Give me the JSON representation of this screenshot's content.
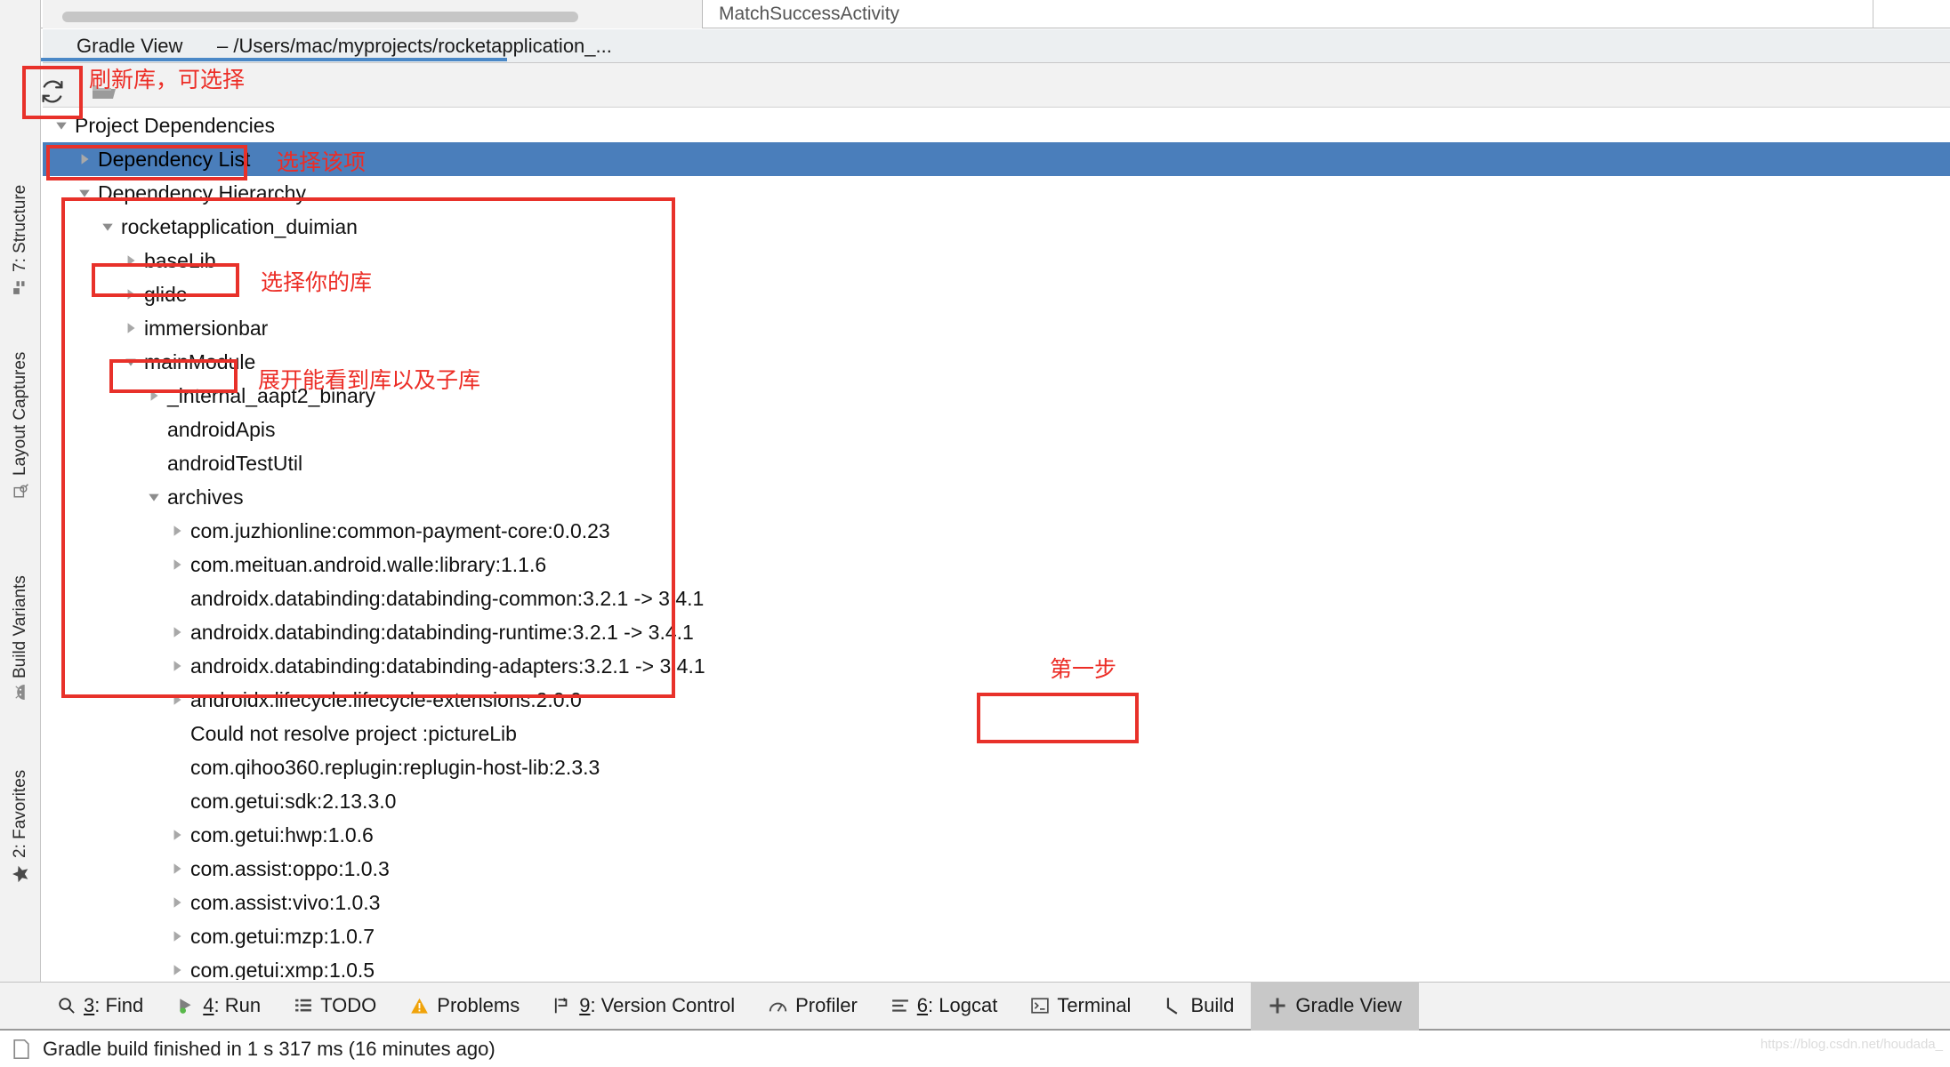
{
  "window": {
    "editor_tab": "MatchSuccessActivity"
  },
  "gradle_view": {
    "title": "Gradle View",
    "separator": "–",
    "project_path": "/Users/mac/myprojects/rocketapplication_...",
    "toolbar": {
      "refresh_icon": "refresh-icon",
      "folder_icon": "folder-icon"
    }
  },
  "sidebar": {
    "items": [
      {
        "label": "7: Structure",
        "icon": "structure-icon"
      },
      {
        "label": "Layout Captures",
        "icon": "layout-captures-icon"
      },
      {
        "label": "Build Variants",
        "icon": "android-icon"
      },
      {
        "label": "2: Favorites",
        "icon": "star-icon"
      }
    ]
  },
  "tree": {
    "rows": [
      {
        "label": "Project Dependencies",
        "indent": 0,
        "twisty": "down",
        "selected": false
      },
      {
        "label": "Dependency List",
        "indent": 1,
        "twisty": "right",
        "selected": true
      },
      {
        "label": "Dependency Hierarchy",
        "indent": 1,
        "twisty": "down",
        "selected": false
      },
      {
        "label": "rocketapplication_duimian",
        "indent": 2,
        "twisty": "down",
        "selected": false
      },
      {
        "label": "baseLib",
        "indent": 3,
        "twisty": "right",
        "selected": false
      },
      {
        "label": "glide",
        "indent": 3,
        "twisty": "right",
        "selected": false
      },
      {
        "label": "immersionbar",
        "indent": 3,
        "twisty": "right",
        "selected": false
      },
      {
        "label": "mainModule",
        "indent": 3,
        "twisty": "down",
        "selected": false
      },
      {
        "label": "_internal_aapt2_binary",
        "indent": 4,
        "twisty": "right",
        "selected": false
      },
      {
        "label": "androidApis",
        "indent": 4,
        "twisty": "none",
        "selected": false
      },
      {
        "label": "androidTestUtil",
        "indent": 4,
        "twisty": "none",
        "selected": false
      },
      {
        "label": "archives",
        "indent": 4,
        "twisty": "down",
        "selected": false
      },
      {
        "label": "com.juzhionline:common-payment-core:0.0.23",
        "indent": 5,
        "twisty": "right",
        "selected": false
      },
      {
        "label": "com.meituan.android.walle:library:1.1.6",
        "indent": 5,
        "twisty": "right",
        "selected": false
      },
      {
        "label": "androidx.databinding:databinding-common:3.2.1 -> 3.4.1",
        "indent": 5,
        "twisty": "none",
        "selected": false
      },
      {
        "label": "androidx.databinding:databinding-runtime:3.2.1 -> 3.4.1",
        "indent": 5,
        "twisty": "right",
        "selected": false
      },
      {
        "label": "androidx.databinding:databinding-adapters:3.2.1 -> 3.4.1",
        "indent": 5,
        "twisty": "right",
        "selected": false
      },
      {
        "label": "androidx.lifecycle:lifecycle-extensions:2.0.0",
        "indent": 5,
        "twisty": "right",
        "selected": false
      },
      {
        "label": "Could not resolve project :pictureLib",
        "indent": 5,
        "twisty": "none",
        "selected": false
      },
      {
        "label": "com.qihoo360.replugin:replugin-host-lib:2.3.3",
        "indent": 5,
        "twisty": "none",
        "selected": false
      },
      {
        "label": "com.getui:sdk:2.13.3.0",
        "indent": 5,
        "twisty": "none",
        "selected": false
      },
      {
        "label": "com.getui:hwp:1.0.6",
        "indent": 5,
        "twisty": "right",
        "selected": false
      },
      {
        "label": "com.assist:oppo:1.0.3",
        "indent": 5,
        "twisty": "right",
        "selected": false
      },
      {
        "label": "com.assist:vivo:1.0.3",
        "indent": 5,
        "twisty": "right",
        "selected": false
      },
      {
        "label": "com.getui:mzp:1.0.7",
        "indent": 5,
        "twisty": "right",
        "selected": false
      },
      {
        "label": "com.getui:xmp:1.0.5",
        "indent": 5,
        "twisty": "right",
        "selected": false
      }
    ]
  },
  "annotations": {
    "color": "#ec2d26",
    "refresh_note": "刷新库，可选择",
    "select_item_note": "选择该项",
    "select_lib_note": "选择你的库",
    "expand_note": "展开能看到库以及子库",
    "first_step_note": "第一步"
  },
  "bottom_bar": {
    "items": [
      {
        "label": "3: Find",
        "shortcut": "3",
        "text": ": Find",
        "icon": "search-icon",
        "active": false
      },
      {
        "label": "4: Run",
        "shortcut": "4",
        "text": ": Run",
        "icon": "run-icon",
        "active": false
      },
      {
        "label": "TODO",
        "shortcut": "",
        "text": "TODO",
        "icon": "todo-icon",
        "active": false
      },
      {
        "label": "Problems",
        "shortcut": "",
        "text": "Problems",
        "icon": "warning-icon",
        "active": false
      },
      {
        "label": "9: Version Control",
        "shortcut": "9",
        "text": ": Version Control",
        "icon": "version-control-icon",
        "active": false
      },
      {
        "label": "Profiler",
        "shortcut": "",
        "text": "Profiler",
        "icon": "profiler-icon",
        "active": false
      },
      {
        "label": "6: Logcat",
        "shortcut": "6",
        "text": ": Logcat",
        "icon": "logcat-icon",
        "active": false
      },
      {
        "label": "Terminal",
        "shortcut": "",
        "text": "Terminal",
        "icon": "terminal-icon",
        "active": false
      },
      {
        "label": "Build",
        "shortcut": "",
        "text": "Build",
        "icon": "build-icon",
        "active": false
      },
      {
        "label": "Gradle View",
        "shortcut": "",
        "text": "Gradle View",
        "icon": "plus-icon",
        "active": true
      }
    ]
  },
  "status_bar": {
    "icon": "document-icon",
    "message": "Gradle build finished in 1 s 317 ms (16 minutes ago)"
  },
  "watermark": "https://blog.csdn.net/houdada_"
}
